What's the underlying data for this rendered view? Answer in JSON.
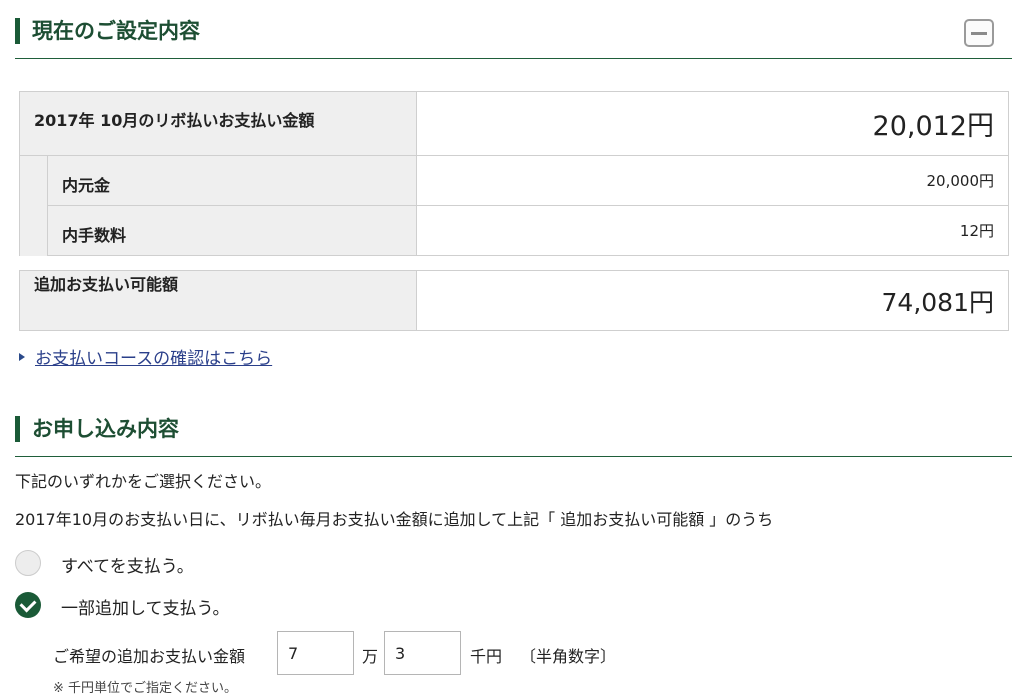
{
  "current_settings": {
    "title": "現在のご設定内容",
    "collapse_icon": "minus-icon",
    "payment_label": "2017年 10月のリボ払いお支払い金額",
    "payment_amount": "20,012円",
    "principal_label": "内元金",
    "principal_amount": "20,000円",
    "fee_label": "内手数料",
    "fee_amount": "12円",
    "additional_label": "追加お支払い可能額",
    "additional_amount": "74,081円"
  },
  "course_link": {
    "text": "お支払いコースの確認はこちら"
  },
  "application": {
    "title": "お申し込み内容",
    "instruction_1": "下記のいずれかをご選択ください。",
    "instruction_2": "2017年10月のお支払い日に、リボ払い毎月お支払い金額に追加して上記「 追加お支払い可能額 」のうち",
    "options": [
      {
        "label": "すべてを支払う。",
        "selected": false
      },
      {
        "label": "一部追加して支払う。",
        "selected": true
      }
    ],
    "amount_label": "ご希望の追加お支払い金額",
    "man_value": "7",
    "man_unit": "万",
    "sen_value": "3",
    "sen_unit": "千円",
    "hint": "〔半角数字〕",
    "note": "※ 千円単位でご指定ください。"
  },
  "colors": {
    "accent_green": "#1a5a37",
    "link_blue": "#2a3f8a",
    "label_bg": "#efefef"
  }
}
